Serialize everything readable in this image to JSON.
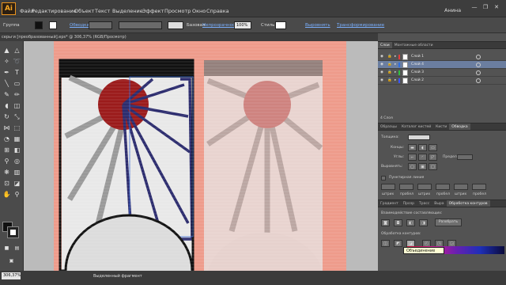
{
  "app": {
    "logo": "Ai",
    "user": "Анина"
  },
  "menu": [
    "Файл",
    "Редактирование",
    "Объект",
    "Текст",
    "Выделение",
    "Эффект",
    "Просмотр",
    "Окно",
    "Справка"
  ],
  "window_controls": [
    "—",
    "❐",
    "✕"
  ],
  "control_bar": {
    "selection_label": "Группа",
    "stroke_label": "Обводка",
    "brush_label": "Базовая",
    "opacity_label": "Непрозрачность:",
    "opacity_value": "100%",
    "style_label": "Стиль:",
    "align_label": "Выровнять",
    "transform_label": "Трансформирование"
  },
  "document_tab": "серьги [преобразованный].eps* @ 306,37% (RGB/Просмотр)",
  "status": {
    "zoom": "306,37%",
    "text": "Выделенный фрагмент"
  },
  "layers_panel": {
    "tabs": [
      "Слои",
      "Монтажные области"
    ],
    "layers": [
      {
        "name": "Слой 1",
        "color": "#e23c3c"
      },
      {
        "name": "Слой 4",
        "color": "#2f6fe0"
      },
      {
        "name": "Слой 3",
        "color": "#2fbf3f"
      },
      {
        "name": "Слой 2",
        "color": "#3a56ff"
      }
    ],
    "footer": "4 Слоя"
  },
  "stroke_panel": {
    "tabs": [
      "Образцы",
      "Каталог кистей",
      "Кисти",
      "Обводка"
    ],
    "weight_label": "Толщина:",
    "cap_label": "Концы:",
    "corner_label": "Углы:",
    "limit_label": "Предел:",
    "align_label": "Выровнять:",
    "dashed_label": "Пунктирная линия",
    "dash_labels": [
      "штрих",
      "пробел",
      "штрих",
      "пробел",
      "штрих",
      "пробел"
    ]
  },
  "pathfinder_panel": {
    "tabs": [
      "Градиент",
      "Прозр",
      "Трасс",
      "Выра",
      "Обработка контуров"
    ],
    "shape_modes_label": "Взаимодействие составляющих:",
    "expand_label": "Разобрать",
    "pathfinders_label": "Обработка контуров:",
    "tooltip": "Объединение"
  }
}
